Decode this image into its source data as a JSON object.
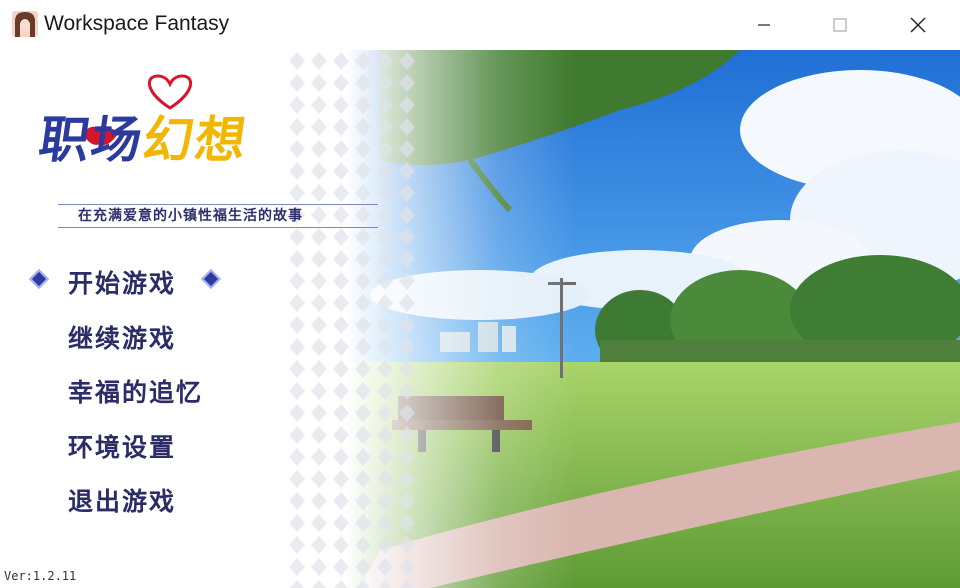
{
  "window": {
    "title": "Workspace Fantasy",
    "minimize_glyph": "minimize-icon",
    "maximize_glyph": "maximize-icon",
    "close_glyph": "close-icon"
  },
  "logo": {
    "title_part1": "职场",
    "title_part2": "幻想",
    "subtitle": "在充满爱意的小镇性福生活的故事",
    "colors": {
      "primary": "#2b3a9e",
      "accent": "#f2b705",
      "lips": "#d8142b"
    }
  },
  "menu": {
    "items": [
      {
        "label": "开始游戏",
        "selected": true
      },
      {
        "label": "继续游戏",
        "selected": false
      },
      {
        "label": "幸福的追忆",
        "selected": false
      },
      {
        "label": "环境设置",
        "selected": false
      },
      {
        "label": "退出游戏",
        "selected": false
      }
    ],
    "text_color": "#2c2c68"
  },
  "version": "Ver:1.2.11"
}
